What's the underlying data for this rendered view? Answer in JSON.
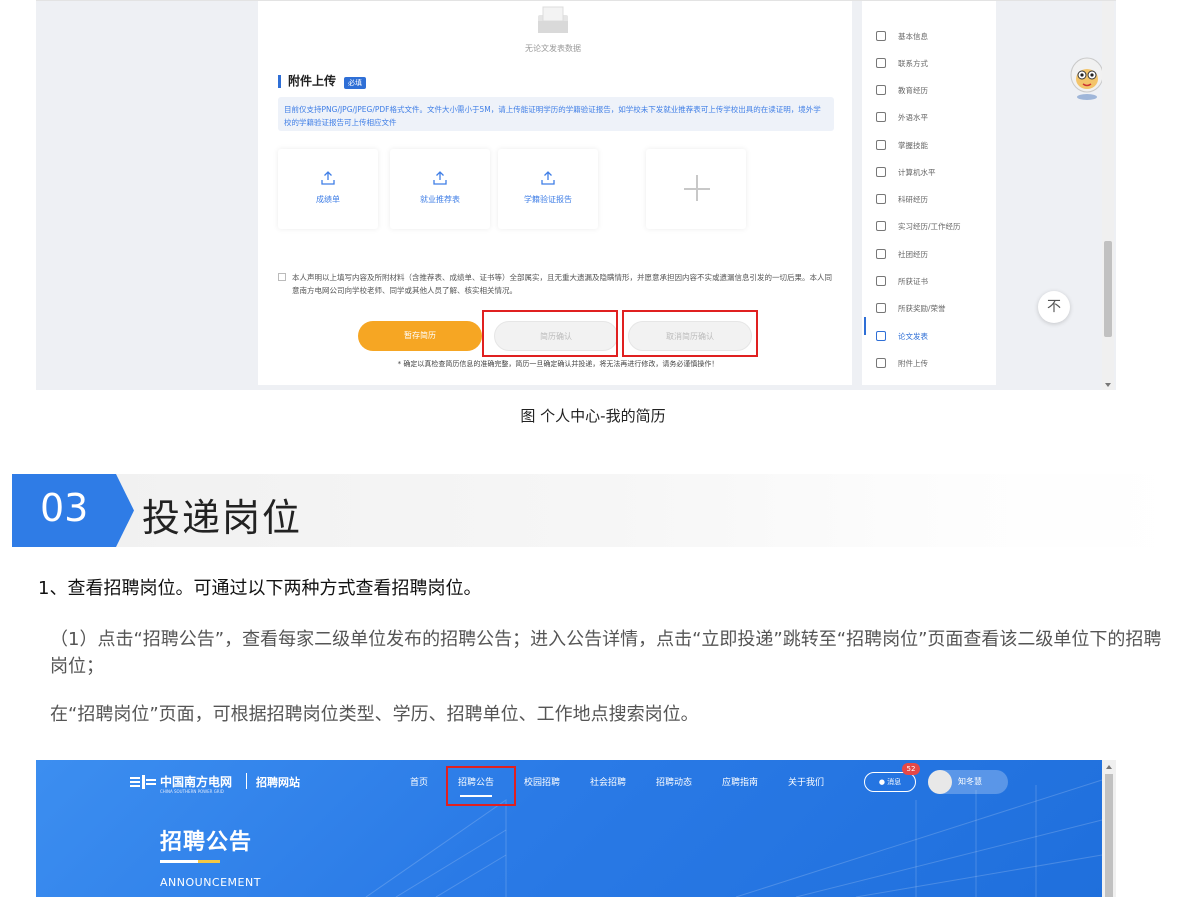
{
  "resume": {
    "no_data": "无论文发表数据",
    "attach_title": "附件上传",
    "attach_badge": "必填",
    "attach_note": "目前仅支持PNG/JPG/JPEG/PDF格式文件。文件大小需小于5M，请上传能证明学历的学籍验证报告，如学校未下发就业推荐表可上传学校出具的在读证明，境外学校的学籍验证报告可上传相应文件",
    "uploads": [
      "成绩单",
      "就业推荐表",
      "学籍验证报告"
    ],
    "declaration": "本人声明以上填写内容及所附材料（含推荐表、成绩单、证书等）全部属实，且无重大遗漏及隐瞒情形，并愿意承担因内容不实或遗漏信息引发的一切后果。本人同意南方电网公司向学校老师、同学或其他人员了解、核实相关情况。",
    "buttons": {
      "save": "暂存简历",
      "confirm": "简历确认",
      "cancel": "取消简历确认"
    },
    "footnote": "* 确定以真检查简历信息的准确完整，简历一旦确定确认并投递，将无法再进行修改，请务必谨慎操作！"
  },
  "side_nav": [
    "基本信息",
    "联系方式",
    "教育经历",
    "外语水平",
    "掌握技能",
    "计算机水平",
    "科研经历",
    "实习经历/工作经历",
    "社团经历",
    "所获证书",
    "所获奖励/荣誉",
    "论文发表",
    "附件上传"
  ],
  "side_nav_active": "论文发表",
  "back_top_glyph": "不",
  "caption1": "图 个人中心-我的简历",
  "section": {
    "number": "03",
    "title": "投递岗位"
  },
  "step1": "1、查看招聘岗位。可通过以下两种方式查看招聘岗位。",
  "para1": "（1）点击“招聘公告”，查看每家二级单位发布的招聘公告；进入公告详情，点击“立即投递”跳转至“招聘岗位”页面查看该二级单位下的招聘岗位；",
  "para2": "在“招聘岗位”页面，可根据招聘岗位类型、学历、招聘单位、工作地点搜索岗位。",
  "portal": {
    "logo_text": "中国南方电网",
    "logo_sub": "CHINA SOUTHERN POWER GRID",
    "site_name": "招聘网站",
    "nav": [
      "首页",
      "招聘公告",
      "校园招聘",
      "社会招聘",
      "招聘动态",
      "应聘指南",
      "关于我们"
    ],
    "nav_active": "招聘公告",
    "msg_label": "消息",
    "msg_count": "52",
    "user_name": "知冬慧",
    "hero_title": "招聘公告",
    "hero_sub": "ANNOUNCEMENT"
  },
  "colors": {
    "accent_blue": "#2f6fd6",
    "orange": "#f6a623",
    "highlight_red": "#e02020"
  }
}
